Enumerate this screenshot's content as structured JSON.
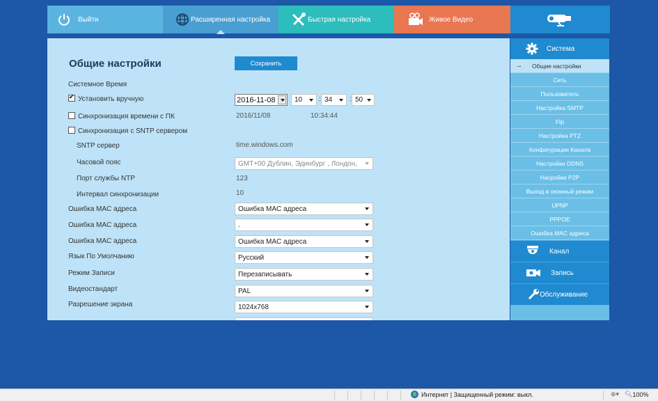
{
  "nav": {
    "logout": "Выйти",
    "advanced": "Расширенная настройка",
    "quick": "Быстрая настройка",
    "live": "Живое Видео"
  },
  "page": {
    "title": "Общие настройки",
    "save": "Сохранить"
  },
  "form": {
    "system_time": "Системное Время",
    "set_manually": "Установить вручную",
    "sync_pc": "Синхронизация времени с ПК",
    "sync_sntp": "Синхронизация с SNTP сервером",
    "date": "2016-11-08",
    "hour": "10",
    "minute": "34",
    "second": "50",
    "pc_date": "2016/11/08",
    "pc_time": "10:34:44",
    "sntp_label": "SNTP сервер",
    "sntp_value": "time.windows.com",
    "timezone_label": "Часовой пояс",
    "timezone_value": "GMT+00 Дублин, Эдинбург , Лондон,",
    "ntp_port_label": "Порт службы NTP",
    "ntp_port_value": "123",
    "sync_interval_label": "Интервал синхронизации",
    "sync_interval_value": "10",
    "mac_err_label_1": "Ошибка MAC адреса",
    "mac_err_value_1": "Ошибка MAC адреса",
    "mac_err_label_2": "Ошибка MAC адреса",
    "mac_err_value_2": ".",
    "mac_err_label_3": "Ошибка MAC адреса",
    "mac_err_value_3": "Ошибка MAC адреса",
    "language_label": "Язык По Умолчанию",
    "language_value": "Русский",
    "record_label": "Режим Записи",
    "record_value": "Перезаписывать",
    "video_std_label": "Видеостандарт",
    "video_std_value": "PAL",
    "resolution_label": "Разрешение экрана",
    "resolution_value": "1024x768"
  },
  "sidebar": {
    "system": "Система",
    "items": [
      "Общие настройки",
      "Сеть",
      "Пользователь",
      "Настройка SMTP",
      "Ftp",
      "Настройка PTZ",
      "Конфигурации Канала",
      "Настройки DDNS",
      "Насройки P2P",
      "Выход в оконный режим",
      "UPNP",
      "PPPOE",
      "Ошибка MAC адреса"
    ],
    "channel": "Канал",
    "record": "Запись",
    "maintenance": "Обслуживание"
  },
  "statusbar": {
    "zone": "Интернет | Защищенный режим: выкл.",
    "zoom": "100%"
  },
  "colors": {
    "background": "#1d57a7",
    "panel": "#bee3f8",
    "accent": "#1f8ad0",
    "nav_logout": "#5bb3e0",
    "nav_advanced": "#4a9fd2",
    "nav_quick": "#2dbdbd",
    "nav_live": "#e87752"
  }
}
